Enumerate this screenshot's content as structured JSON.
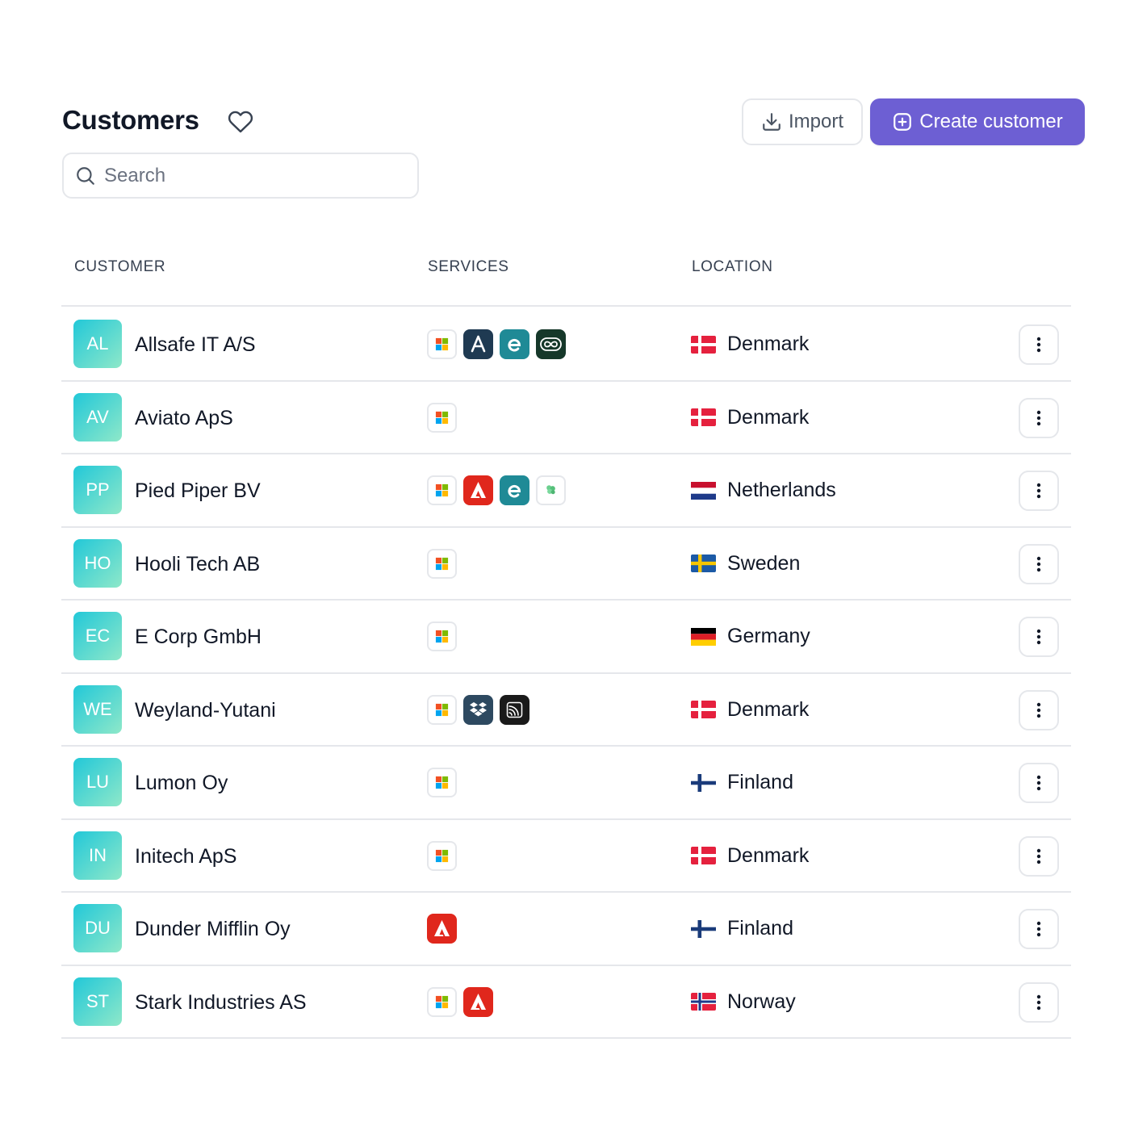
{
  "header": {
    "title": "Customers",
    "import_label": "Import",
    "create_label": "Create customer"
  },
  "search": {
    "placeholder": "Search"
  },
  "columns": {
    "customer": "CUSTOMER",
    "services": "SERVICES",
    "location": "LOCATION"
  },
  "colors": {
    "accent": "#6d5fd3",
    "avatar_gradient_start": "#22c8d8",
    "avatar_gradient_end": "#8ee8c9"
  },
  "customers": [
    {
      "initials": "AL",
      "name": "Allsafe IT A/S",
      "services": [
        "microsoft-icon",
        "autotask-icon",
        "exclaimer-icon",
        "infinity-icon"
      ],
      "location": "Denmark",
      "flag": "dk"
    },
    {
      "initials": "AV",
      "name": "Aviato ApS",
      "services": [
        "microsoft-icon"
      ],
      "location": "Denmark",
      "flag": "dk"
    },
    {
      "initials": "PP",
      "name": "Pied Piper BV",
      "services": [
        "microsoft-icon",
        "adobe-icon",
        "exclaimer-icon",
        "clover-icon"
      ],
      "location": "Netherlands",
      "flag": "nl"
    },
    {
      "initials": "HO",
      "name": "Hooli Tech AB",
      "services": [
        "microsoft-icon"
      ],
      "location": "Sweden",
      "flag": "se"
    },
    {
      "initials": "EC",
      "name": "E Corp GmbH",
      "services": [
        "microsoft-icon"
      ],
      "location": "Germany",
      "flag": "de"
    },
    {
      "initials": "WE",
      "name": "Weyland-Yutani",
      "services": [
        "microsoft-icon",
        "dropbox-icon",
        "signal-icon"
      ],
      "location": "Denmark",
      "flag": "dk"
    },
    {
      "initials": "LU",
      "name": "Lumon Oy",
      "services": [
        "microsoft-icon"
      ],
      "location": "Finland",
      "flag": "fi"
    },
    {
      "initials": "IN",
      "name": "Initech ApS",
      "services": [
        "microsoft-icon"
      ],
      "location": "Denmark",
      "flag": "dk"
    },
    {
      "initials": "DU",
      "name": "Dunder Mifflin Oy",
      "services": [
        "adobe-icon"
      ],
      "location": "Finland",
      "flag": "fi"
    },
    {
      "initials": "ST",
      "name": "Stark Industries AS",
      "services": [
        "microsoft-icon",
        "adobe-icon"
      ],
      "location": "Norway",
      "flag": "no"
    }
  ]
}
